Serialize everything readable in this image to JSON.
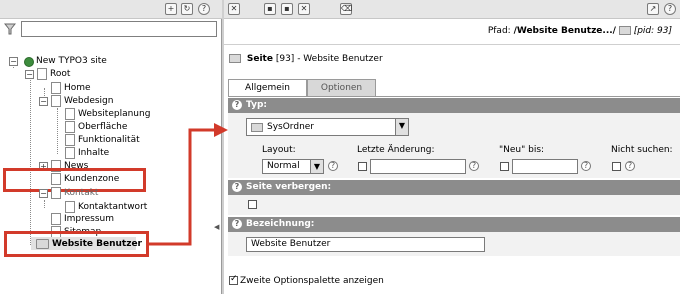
{
  "tree": {
    "site": "New TYPO3 site",
    "items": [
      {
        "label": "Root"
      },
      {
        "label": "Home"
      },
      {
        "label": "Webdesign"
      },
      {
        "label": "Websiteplanung"
      },
      {
        "label": "Oberfläche"
      },
      {
        "label": "Funktionalität"
      },
      {
        "label": "Inhalte"
      },
      {
        "label": "News"
      },
      {
        "label": "Kundenzone"
      },
      {
        "label": "Kontakt"
      },
      {
        "label": "Kontaktantwort"
      },
      {
        "label": "Impressum"
      },
      {
        "label": "Sitemap"
      },
      {
        "label": "Website Benutzer"
      }
    ]
  },
  "right": {
    "path_label": "Pfad:",
    "path_value": "/Website Benutze.../",
    "pid": "[pid: 93]",
    "page_kind": "Seite",
    "page_id": "[93]",
    "page_title": "- Website Benutzer"
  },
  "tabs": [
    {
      "label": "Allgemein"
    },
    {
      "label": "Optionen"
    }
  ],
  "form": {
    "typ_label": "Typ:",
    "typ_value": "SysOrdner",
    "layout_label": "Layout:",
    "layout_value": "Normal",
    "last_change_label": "Letzte Änderung:",
    "neu_label": "\"Neu\" bis:",
    "nicht_suchen_label": "Nicht suchen:",
    "hide_label": "Seite verbergen:",
    "title_label": "Bezeichnung:",
    "title_value": "Website Benutzer",
    "second_palette_label": "Zweite Optionspalette anzeigen"
  },
  "colors": {
    "highlight": "#d23a2a",
    "section_head": "#8c8c8c",
    "toolbar": "#e6e6e6"
  }
}
